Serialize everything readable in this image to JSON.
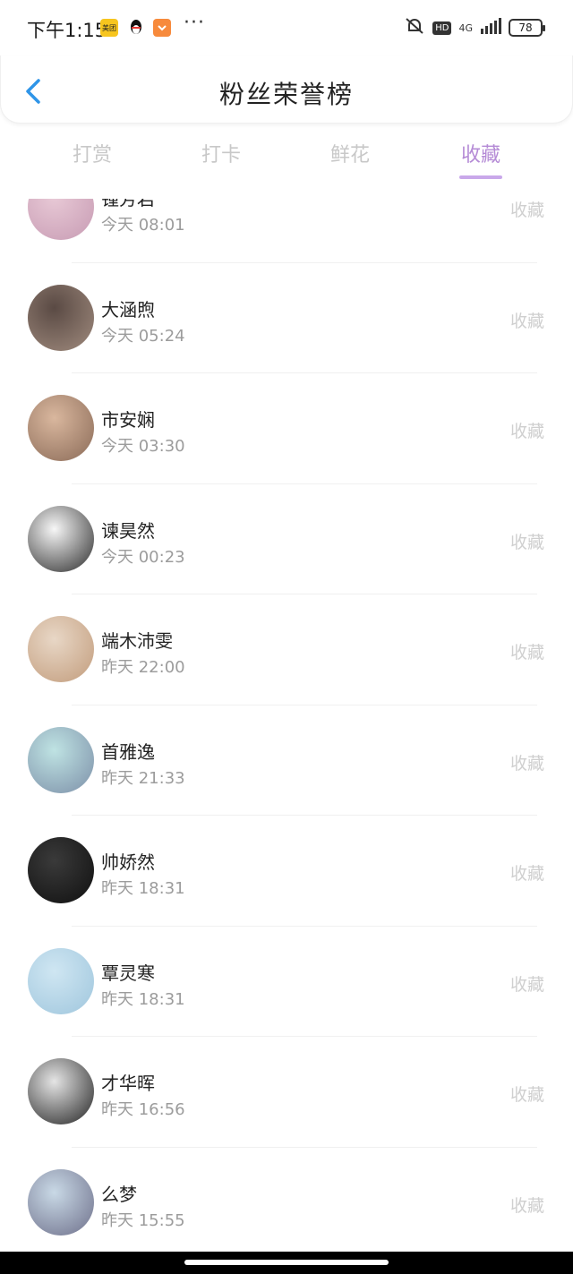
{
  "status": {
    "time": "下午1:15",
    "meituan": "美团",
    "network": "4G",
    "hd": "HD",
    "battery": "78"
  },
  "header": {
    "title": "粉丝荣誉榜"
  },
  "tabs": [
    {
      "label": "打赏"
    },
    {
      "label": "打卡"
    },
    {
      "label": "鲜花"
    },
    {
      "label": "收藏"
    }
  ],
  "rows": [
    {
      "name": "锺芳岩",
      "time": "今天 08:01",
      "action": "收藏",
      "avatar_colors": [
        "#e8c9d6",
        "#c79bb3"
      ]
    },
    {
      "name": "大涵煦",
      "time": "今天 05:24",
      "action": "收藏",
      "avatar_colors": [
        "#5a4a44",
        "#a08b7e"
      ]
    },
    {
      "name": "市安娴",
      "time": "今天 03:30",
      "action": "收藏",
      "avatar_colors": [
        "#d9b79e",
        "#8a6a57"
      ]
    },
    {
      "name": "谏昊然",
      "time": "今天 00:23",
      "action": "收藏",
      "avatar_colors": [
        "#f7f7f7",
        "#2b2b2b"
      ]
    },
    {
      "name": "端木沛雯",
      "time": "昨天 22:00",
      "action": "收藏",
      "avatar_colors": [
        "#e8d7c6",
        "#c29c7c"
      ]
    },
    {
      "name": "首雅逸",
      "time": "昨天 21:33",
      "action": "收藏",
      "avatar_colors": [
        "#bfe3e3",
        "#7c8fa8"
      ]
    },
    {
      "name": "帅娇然",
      "time": "昨天 18:31",
      "action": "收藏",
      "avatar_colors": [
        "#3a3a3a",
        "#101010"
      ]
    },
    {
      "name": "覃灵寒",
      "time": "昨天 18:31",
      "action": "收藏",
      "avatar_colors": [
        "#cfe6f2",
        "#9fc6dd"
      ]
    },
    {
      "name": "才华晖",
      "time": "昨天 16:56",
      "action": "收藏",
      "avatar_colors": [
        "#e5e5e5",
        "#222222"
      ]
    },
    {
      "name": "么梦",
      "time": "昨天 15:55",
      "action": "收藏",
      "avatar_colors": [
        "#c9d9e6",
        "#6d6f8a"
      ]
    }
  ],
  "colors": {
    "accent": "#b58bd6",
    "underline": "#c9a8ea",
    "back": "#2f95e8"
  }
}
